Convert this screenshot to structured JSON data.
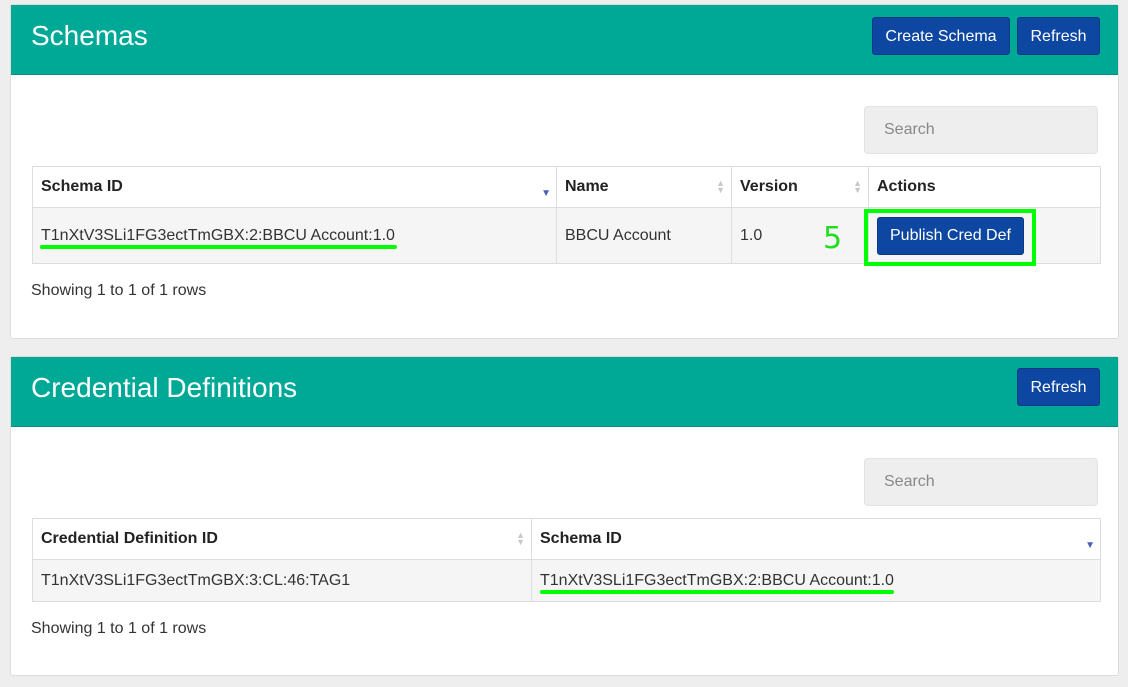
{
  "schemas": {
    "title": "Schemas",
    "create_label": "Create Schema",
    "refresh_label": "Refresh",
    "search_placeholder": "Search",
    "columns": [
      "Schema ID",
      "Name",
      "Version",
      "Actions"
    ],
    "rows": [
      {
        "schema_id": "T1nXtV3SLi1FG3ectTmGBX:2:BBCU Account:1.0",
        "name": "BBCU Account",
        "version": "1.0",
        "action_label": "Publish Cred Def"
      }
    ],
    "footer": "Showing 1 to 1 of 1 rows",
    "annotation_step": "5"
  },
  "cred_defs": {
    "title": "Credential Definitions",
    "refresh_label": "Refresh",
    "search_placeholder": "Search",
    "columns": [
      "Credential Definition ID",
      "Schema ID"
    ],
    "rows": [
      {
        "cred_def_id": "T1nXtV3SLi1FG3ectTmGBX:3:CL:46:TAG1",
        "schema_id": "T1nXtV3SLi1FG3ectTmGBX:2:BBCU Account:1.0"
      }
    ],
    "footer": "Showing 1 to 1 of 1 rows"
  },
  "colors": {
    "header": "#00a896",
    "button": "#0d47a1",
    "annotation": "#00ff00"
  }
}
